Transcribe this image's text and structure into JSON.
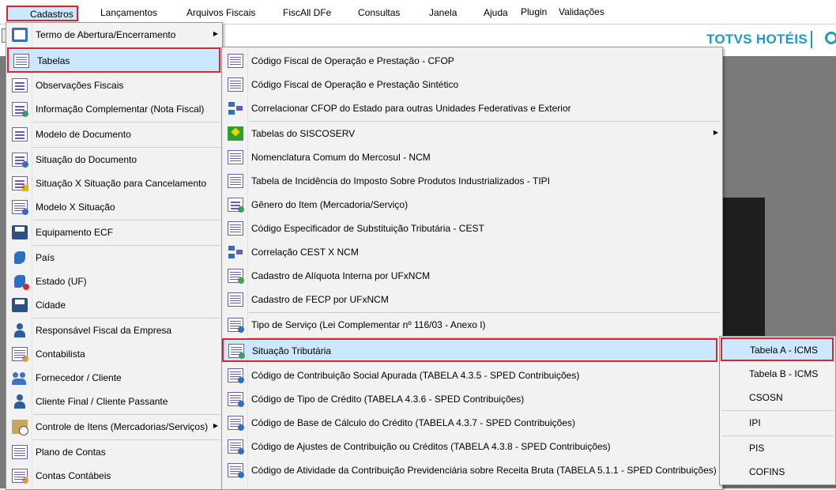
{
  "menubar": {
    "items": [
      "Cadastros",
      "Lançamentos",
      "Arquivos Fiscais",
      "FiscAll DFe",
      "Consultas",
      "Janela",
      "Ajuda",
      "Plugin",
      "Validações"
    ]
  },
  "brand": {
    "text": "TOTVS HOTÉIS",
    "color": "#1a9dc0"
  },
  "cadastros_menu": {
    "items": [
      {
        "label": "Termo de Abertura/Encerramento",
        "icon": "book-icon",
        "submenu": true
      },
      {
        "label": "Tabelas",
        "icon": "table-icon",
        "submenu": false
      },
      {
        "label": "Observações Fiscais",
        "icon": "binoculars-document-icon"
      },
      {
        "label": "Informação Complementar (Nota Fiscal)",
        "icon": "document-add-icon"
      },
      {
        "label": "Modelo de Documento",
        "icon": "document-icon"
      },
      {
        "label": "Situação do Documento",
        "icon": "document-info-icon"
      },
      {
        "label": "Situação X Situação para Cancelamento",
        "icon": "document-warning-icon"
      },
      {
        "label": "Modelo X Situação",
        "icon": "table-info-icon"
      },
      {
        "label": "Equipamento ECF",
        "icon": "printer-icon"
      },
      {
        "label": "País",
        "icon": "map-icon"
      },
      {
        "label": "Estado (UF)",
        "icon": "map-state-icon"
      },
      {
        "label": "Cidade",
        "icon": "city-icon"
      },
      {
        "label": "Responsável Fiscal da Empresa",
        "icon": "user-icon"
      },
      {
        "label": "Contabilista",
        "icon": "accountant-icon"
      },
      {
        "label": "Fornecedor / Cliente",
        "icon": "users-icon"
      },
      {
        "label": "Cliente Final / Cliente Passante",
        "icon": "user-icon"
      },
      {
        "label": "Controle de Itens (Mercadorias/Serviços)",
        "icon": "box-clock-icon",
        "submenu": true
      },
      {
        "label": "Plano de Contas",
        "icon": "table-icon"
      },
      {
        "label": "Contas Contábeis",
        "icon": "ledger-icon"
      }
    ]
  },
  "tabelas_menu": {
    "items": [
      {
        "label": "Código Fiscal de Operação e Prestação - CFOP",
        "icon": "cfop-icon"
      },
      {
        "label": "Código Fiscal de Operação e Prestação Sintético",
        "icon": "cfop-icon"
      },
      {
        "label": "Correlacionar CFOP do Estado para outras Unidades Federativas e Exterior",
        "icon": "correlation-icon"
      },
      {
        "label": "Tabelas do SISCOSERV",
        "icon": "brazil-flag-icon",
        "submenu": true
      },
      {
        "label": "Nomenclatura Comum do Mercosul  - NCM",
        "icon": "ncm-icon"
      },
      {
        "label": "Tabela de Incidência do Imposto Sobre Produtos Industrializados - TIPI",
        "icon": "tipi-icon"
      },
      {
        "label": "Gênero do Item (Mercadoria/Serviço)",
        "icon": "genre-icon"
      },
      {
        "label": "Código Especificador de Substituição Tributária - CEST",
        "icon": "cest-icon"
      },
      {
        "label": "Correlação CEST X NCM",
        "icon": "correlation-icon"
      },
      {
        "label": "Cadastro de Alíquota Interna por UFxNCM",
        "icon": "rate-icon"
      },
      {
        "label": "Cadastro de FECP por UFxNCM",
        "icon": "fecp-icon"
      },
      {
        "label": "Tipo de Serviço (Lei Complementar nº 116/03 - Anexo I)",
        "icon": "tools-icon"
      },
      {
        "label": "Situação Tributária",
        "icon": "tax-situation-icon"
      },
      {
        "label": "Código de Contribuição Social Apurada (TABELA 4.3.5 - SPED Contribuições)",
        "icon": "sped-icon"
      },
      {
        "label": "Código de Tipo de Crédito (TABELA 4.3.6 - SPED Contribuições)",
        "icon": "sped-icon"
      },
      {
        "label": "Código de Base de Cálculo do Crédito (TABELA 4.3.7 - SPED Contribuições)",
        "icon": "sped-icon"
      },
      {
        "label": "Código de Ajustes de Contribuição ou Créditos (TABELA 4.3.8 - SPED Contribuições)",
        "icon": "sped-dollar-icon"
      },
      {
        "label": "Código de Atividade da Contribuição Previdenciária sobre Receita Bruta (TABELA 5.1.1 - SPED Contribuições)",
        "icon": "sped-user-icon"
      }
    ]
  },
  "situacao_menu": {
    "items": [
      "Tabela A - ICMS",
      "Tabela B - ICMS",
      "CSOSN",
      "IPI",
      "PIS",
      "COFINS"
    ]
  }
}
